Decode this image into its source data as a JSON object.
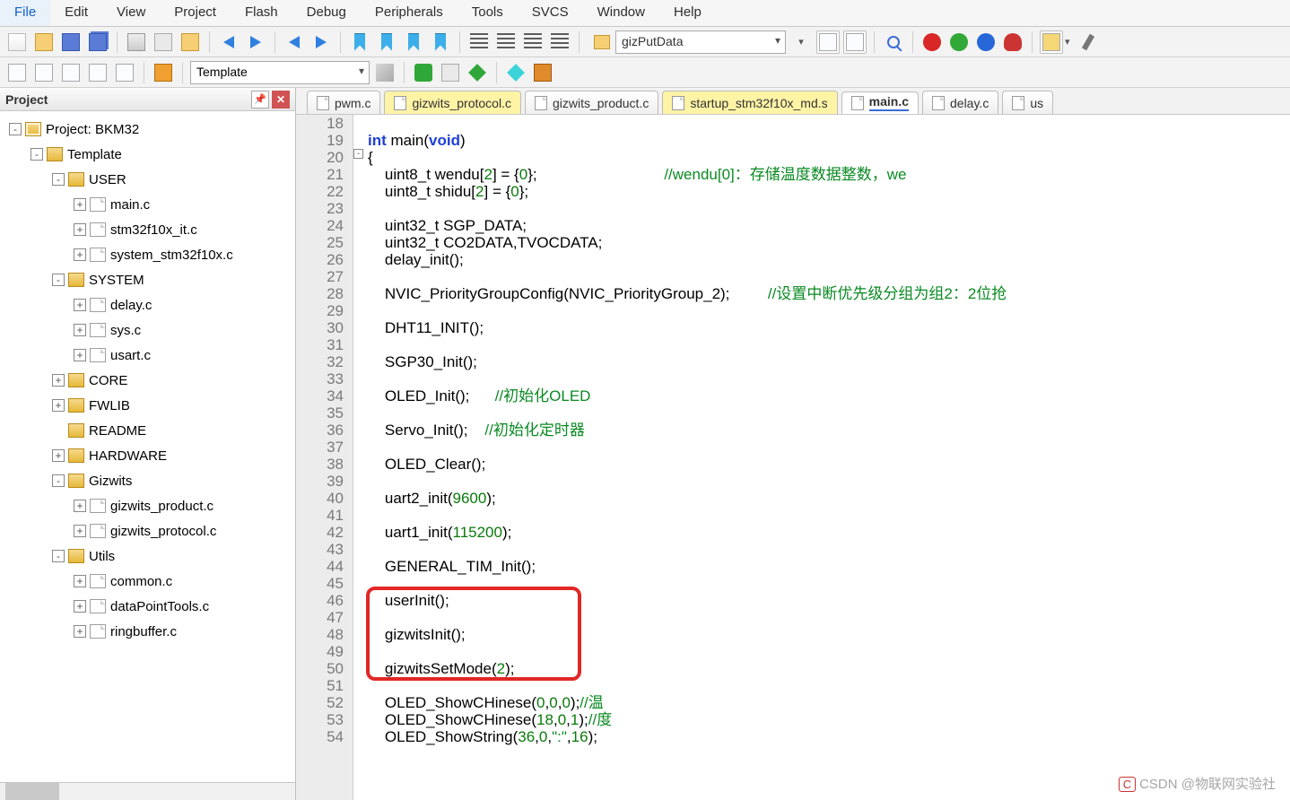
{
  "menu": {
    "items": [
      "File",
      "Edit",
      "View",
      "Project",
      "Flash",
      "Debug",
      "Peripherals",
      "Tools",
      "SVCS",
      "Window",
      "Help"
    ],
    "selected": 0
  },
  "toolbar": {
    "search_text": "gizPutData",
    "template_text": "Template"
  },
  "project_panel": {
    "title": "Project",
    "root": "Project: BKM32",
    "tree": [
      {
        "d": 0,
        "tw": "-",
        "icon": "proj",
        "label": "Project: BKM32"
      },
      {
        "d": 1,
        "tw": "-",
        "icon": "grp",
        "label": "Template"
      },
      {
        "d": 2,
        "tw": "-",
        "icon": "fold",
        "label": "USER"
      },
      {
        "d": 3,
        "tw": "+",
        "icon": "file",
        "label": "main.c"
      },
      {
        "d": 3,
        "tw": "+",
        "icon": "file",
        "label": "stm32f10x_it.c"
      },
      {
        "d": 3,
        "tw": "+",
        "icon": "file",
        "label": "system_stm32f10x.c"
      },
      {
        "d": 2,
        "tw": "-",
        "icon": "fold",
        "label": "SYSTEM"
      },
      {
        "d": 3,
        "tw": "+",
        "icon": "file",
        "label": "delay.c"
      },
      {
        "d": 3,
        "tw": "+",
        "icon": "file",
        "label": "sys.c"
      },
      {
        "d": 3,
        "tw": "+",
        "icon": "file",
        "label": "usart.c"
      },
      {
        "d": 2,
        "tw": "+",
        "icon": "fold",
        "label": "CORE"
      },
      {
        "d": 2,
        "tw": "+",
        "icon": "fold",
        "label": "FWLIB"
      },
      {
        "d": 2,
        "tw": "",
        "icon": "fold",
        "label": "README"
      },
      {
        "d": 2,
        "tw": "+",
        "icon": "fold",
        "label": "HARDWARE"
      },
      {
        "d": 2,
        "tw": "-",
        "icon": "fold",
        "label": "Gizwits"
      },
      {
        "d": 3,
        "tw": "+",
        "icon": "file",
        "label": "gizwits_product.c"
      },
      {
        "d": 3,
        "tw": "+",
        "icon": "file",
        "label": "gizwits_protocol.c"
      },
      {
        "d": 2,
        "tw": "-",
        "icon": "fold",
        "label": "Utils"
      },
      {
        "d": 3,
        "tw": "+",
        "icon": "file",
        "label": "common.c"
      },
      {
        "d": 3,
        "tw": "+",
        "icon": "file",
        "label": "dataPointTools.c"
      },
      {
        "d": 3,
        "tw": "+",
        "icon": "file",
        "label": "ringbuffer.c"
      }
    ]
  },
  "tabs": [
    {
      "label": "pwm.c",
      "state": ""
    },
    {
      "label": "gizwits_protocol.c",
      "state": "active"
    },
    {
      "label": "gizwits_product.c",
      "state": ""
    },
    {
      "label": "startup_stm32f10x_md.s",
      "state": "active"
    },
    {
      "label": "main.c",
      "state": "sel"
    },
    {
      "label": "delay.c",
      "state": ""
    },
    {
      "label": "us",
      "state": ""
    }
  ],
  "code": {
    "first_line": 18,
    "lines": [
      "",
      "<kw>int</kw> main(<kw>void</kw>)",
      "{",
      "    uint8_t wendu[<num>2</num>] = {<num>0</num>};                              <cm>//wendu[0]：存储温度数据整数，we</cm>",
      "    uint8_t shidu[<num>2</num>] = {<num>0</num>};",
      "",
      "    uint32_t SGP_DATA;",
      "    uint32_t CO2DATA,TVOCDATA;",
      "    delay_init();",
      "",
      "    NVIC_PriorityGroupConfig(NVIC_PriorityGroup_2);         <cm>//设置中断优先级分组为组2：2位抢</cm>",
      "",
      "    DHT11_INIT();",
      "",
      "    SGP30_Init();",
      "",
      "    OLED_Init();      <cm>//初始化OLED</cm>",
      "",
      "    Servo_Init();    <cm>//初始化定时器</cm>",
      "",
      "    OLED_Clear();",
      "",
      "    uart2_init(<num>9600</num>);",
      "",
      "    uart1_init(<num>115200</num>);",
      "",
      "    GENERAL_TIM_Init();",
      "",
      "    userInit();",
      "",
      "    gizwitsInit();",
      "",
      "    gizwitsSetMode(<num>2</num>);",
      "",
      "    OLED_ShowCHinese(<num>0</num>,<num>0</num>,<num>0</num>);<cm>//温</cm>",
      "    OLED_ShowCHinese(<num>18</num>,<num>0</num>,<num>1</num>);<cm>//度</cm>",
      "    OLED_ShowString(<num>36</num>,<num>0</num>,<cm>\":\"</cm>,<num>16</num>);"
    ],
    "highlight_box": {
      "top_line": 46,
      "bottom_line": 50
    }
  },
  "watermark": "CSDN @物联网实验社"
}
